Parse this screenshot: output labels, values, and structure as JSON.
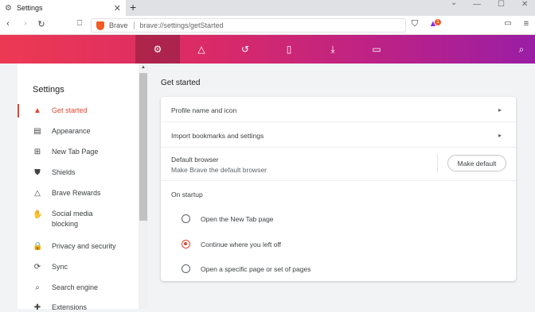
{
  "tab": {
    "title": "Settings",
    "close": "✕",
    "new_tab": "+"
  },
  "window": {
    "minimize": "—",
    "maximize": "☐",
    "close": "✕"
  },
  "toolbar": {
    "brand": "Brave",
    "url": "brave://settings/getStarted",
    "rewards_badge": "1"
  },
  "nav": {
    "items": [
      "settings-icon",
      "rewards-icon",
      "history-icon",
      "bookmarks-icon",
      "downloads-icon",
      "wallet-icon"
    ],
    "search": "search-icon"
  },
  "sidebar": {
    "title": "Settings",
    "items": [
      {
        "label": "Get started"
      },
      {
        "label": "Appearance"
      },
      {
        "label": "New Tab Page"
      },
      {
        "label": "Shields"
      },
      {
        "label": "Brave Rewards"
      },
      {
        "label": "Social media",
        "label2": "blocking"
      },
      {
        "label": "Privacy and security"
      },
      {
        "label": "Sync"
      },
      {
        "label": "Search engine"
      },
      {
        "label": "Extensions"
      }
    ]
  },
  "main": {
    "title": "Get started",
    "profile": "Profile name and icon",
    "import": "Import bookmarks and settings",
    "default_browser": {
      "title": "Default browser",
      "subtitle": "Make Brave the default browser",
      "button": "Make default"
    },
    "startup": {
      "title": "On startup",
      "options": [
        {
          "label": "Open the New Tab page",
          "selected": false
        },
        {
          "label": "Continue where you left off",
          "selected": true
        },
        {
          "label": "Open a specific page or set of pages",
          "selected": false
        }
      ]
    }
  },
  "colors": {
    "accent": "#e0472e",
    "gradient_start": "#ec3953",
    "gradient_end": "#9a1ea4"
  }
}
